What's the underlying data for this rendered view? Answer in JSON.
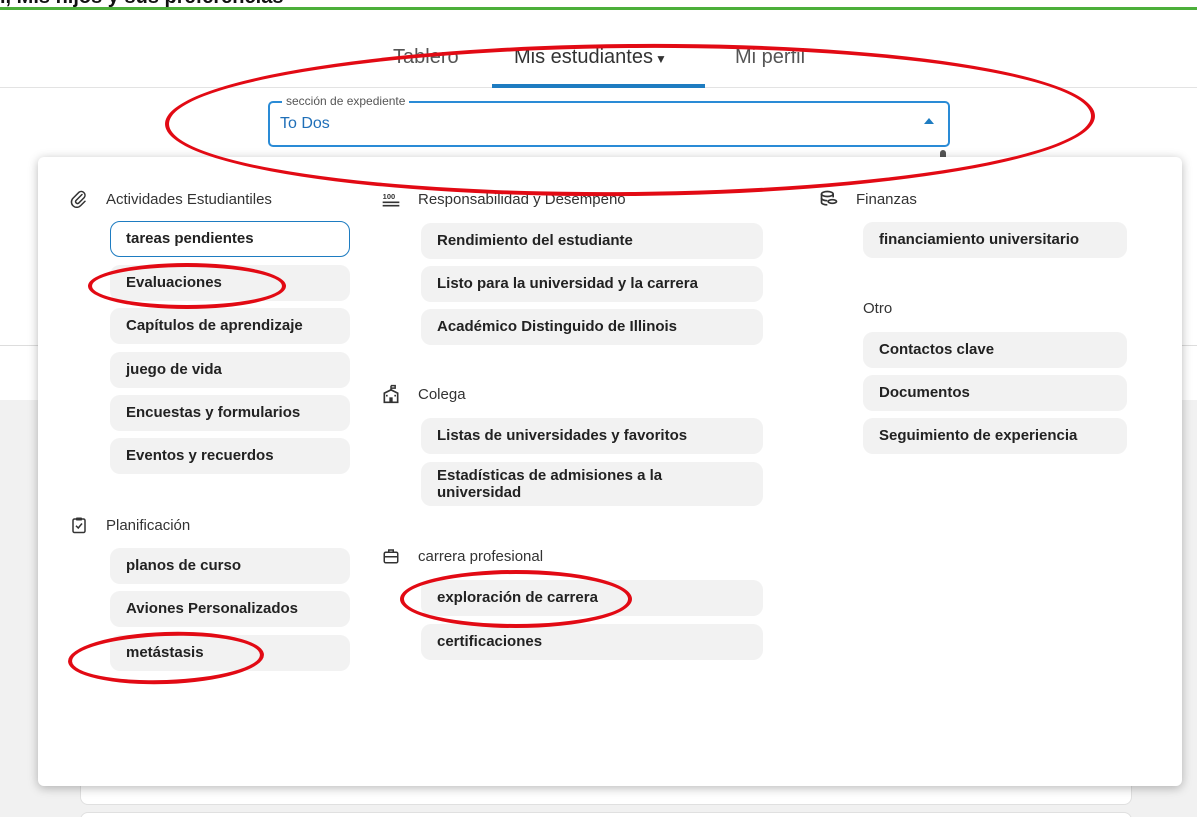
{
  "top_text": "i, Mis hijos y sus preferencias",
  "nav": {
    "tabs": [
      {
        "label": "Tablero"
      },
      {
        "label": "Mis estudiantes"
      },
      {
        "label": "Mi perfil"
      }
    ]
  },
  "section_select": {
    "legend": "sección de expediente",
    "value": "To Dos"
  },
  "menu": {
    "activities": {
      "title": "Actividades Estudiantiles",
      "items": [
        "tareas pendientes",
        "Evaluaciones",
        "Capítulos de aprendizaje",
        "juego de vida",
        "Encuestas y formularios",
        "Eventos y recuerdos"
      ]
    },
    "planning": {
      "title": "Planificación",
      "items": [
        "planos de curso",
        "Aviones Personalizados",
        "metástasis"
      ]
    },
    "responsibility": {
      "title": "Responsabilidad y Desempeño",
      "items": [
        "Rendimiento del estudiante",
        "Listo para la universidad y la carrera",
        "Académico Distinguido de Illinois"
      ]
    },
    "college": {
      "title": "Colega",
      "items": [
        "Listas de universidades y favoritos",
        "Estadísticas de admisiones a la universidad"
      ]
    },
    "career": {
      "title": "carrera profesional",
      "items": [
        "exploración de carrera",
        "certificaciones"
      ]
    },
    "finance": {
      "title": "Finanzas",
      "items": [
        "financiamiento universitario"
      ]
    },
    "other": {
      "title": "Otro",
      "items": [
        "Contactos clave",
        "Documentos",
        "Seguimiento de experiencia"
      ]
    }
  },
  "colors": {
    "accent": "#1e7cc1",
    "annotation": "#e20a14",
    "top_bar": "#4caf3a"
  }
}
